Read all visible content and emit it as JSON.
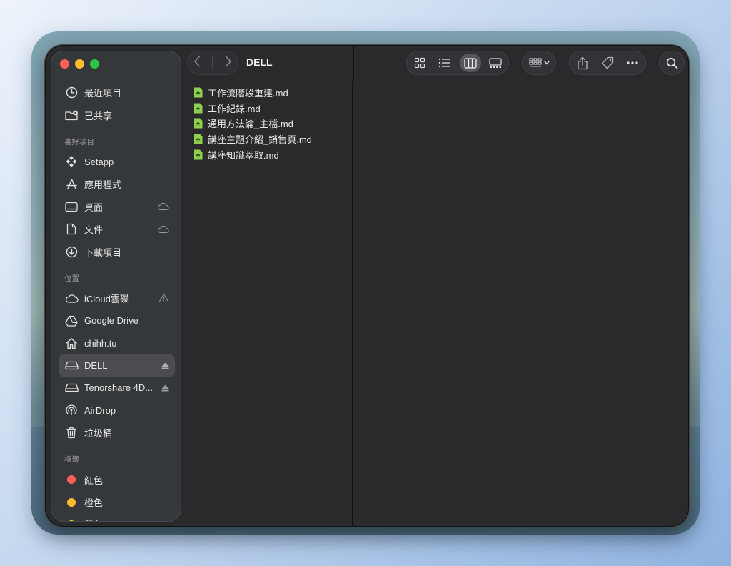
{
  "window": {
    "title": "DELL"
  },
  "sidebar": {
    "top_items": [
      {
        "label": "最近項目",
        "icon": "clock-icon"
      },
      {
        "label": "已共享",
        "icon": "shared-folder-icon"
      }
    ],
    "favorites_header": "喜好項目",
    "favorites": [
      {
        "label": "Setapp",
        "icon": "setapp-icon"
      },
      {
        "label": "應用程式",
        "icon": "applications-icon"
      },
      {
        "label": "桌面",
        "icon": "desktop-icon",
        "trail": "cloud-icon"
      },
      {
        "label": "文件",
        "icon": "document-icon",
        "trail": "cloud-icon"
      },
      {
        "label": "下載項目",
        "icon": "download-icon"
      }
    ],
    "locations_header": "位置",
    "locations": [
      {
        "label": "iCloud雲碟",
        "icon": "cloud-icon",
        "trail": "warning-icon"
      },
      {
        "label": "Google Drive",
        "icon": "google-drive-icon"
      },
      {
        "label": "chihh.tu",
        "icon": "home-icon"
      },
      {
        "label": "DELL",
        "icon": "drive-icon",
        "trail": "eject-icon",
        "active": true
      },
      {
        "label": "Tenorshare 4D...",
        "icon": "drive-icon",
        "trail": "eject-icon"
      },
      {
        "label": "AirDrop",
        "icon": "airdrop-icon"
      },
      {
        "label": "垃圾桶",
        "icon": "trash-icon"
      }
    ],
    "tags_header": "標籤",
    "tags": [
      {
        "label": "紅色",
        "color": "#fe5f57"
      },
      {
        "label": "橙色",
        "color": "#febc2e"
      },
      {
        "label": "黃色",
        "color": "#f7e12b"
      }
    ]
  },
  "files": [
    "工作流階段重建.md",
    "工作紀錄.md",
    "通用方法論_主檔.md",
    "講座主題介紹_銷售頁.md",
    "講座知識萃取.md"
  ],
  "toolbar": {
    "view_modes": [
      "icon-view-icon",
      "list-view-icon",
      "column-view-icon",
      "gallery-view-icon"
    ],
    "active_view": "column-view-icon"
  }
}
